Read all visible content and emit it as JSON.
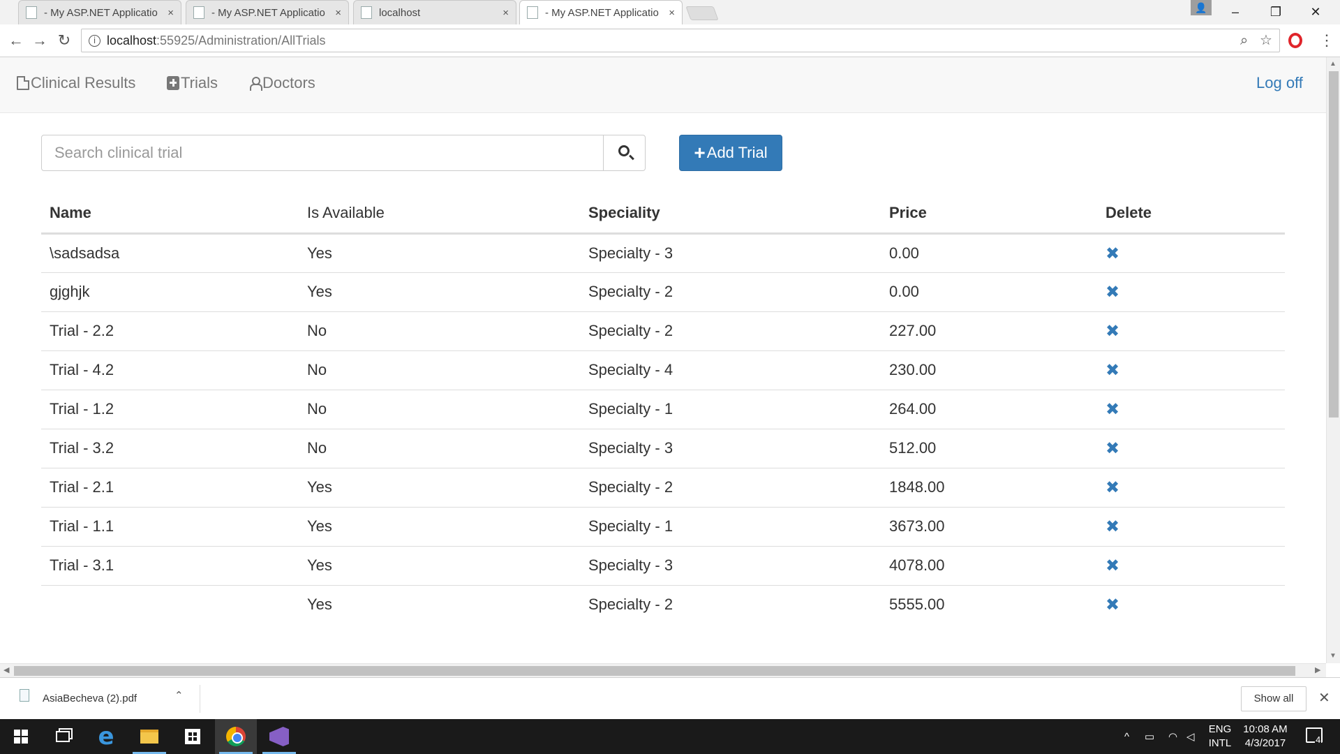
{
  "browser": {
    "tabs": [
      {
        "title": "- My ASP.NET Applicatio",
        "active": false
      },
      {
        "title": "- My ASP.NET Applicatio",
        "active": false
      },
      {
        "title": "localhost",
        "active": false
      },
      {
        "title": "- My ASP.NET Applicatio",
        "active": true
      }
    ],
    "tab_close": "×",
    "url_host": "localhost",
    "url_path": ":55925/Administration/AllTrials",
    "info_glyph": "i",
    "window_buttons": {
      "minimize": "–",
      "restore": "❐",
      "close": "✕"
    },
    "nav": {
      "back": "←",
      "forward": "→",
      "reload": "↻"
    },
    "zoom_glyph": "⌕",
    "star_glyph": "☆",
    "menu_glyph": "⋮",
    "user_glyph": "👤"
  },
  "navbar": {
    "links": [
      {
        "label": "Clinical Results",
        "icon": "file-icon"
      },
      {
        "label": "Trials",
        "icon": "plus-square-icon"
      },
      {
        "label": "Doctors",
        "icon": "user-icon"
      }
    ],
    "logoff": "Log off"
  },
  "search": {
    "placeholder": "Search clinical trial",
    "value": ""
  },
  "add_button": {
    "plus": "+",
    "label": "Add Trial"
  },
  "table": {
    "headers": [
      "Name",
      "Is Available",
      "Speciality",
      "Price",
      "Delete"
    ],
    "rows": [
      {
        "name": "\\sadsadsa",
        "available": "Yes",
        "speciality": "Specialty - 3",
        "price": "0.00"
      },
      {
        "name": "gjghjk",
        "available": "Yes",
        "speciality": "Specialty - 2",
        "price": "0.00"
      },
      {
        "name": "Trial - 2.2",
        "available": "No",
        "speciality": "Specialty - 2",
        "price": "227.00"
      },
      {
        "name": "Trial - 4.2",
        "available": "No",
        "speciality": "Specialty - 4",
        "price": "230.00"
      },
      {
        "name": "Trial - 1.2",
        "available": "No",
        "speciality": "Specialty - 1",
        "price": "264.00"
      },
      {
        "name": "Trial - 3.2",
        "available": "No",
        "speciality": "Specialty - 3",
        "price": "512.00"
      },
      {
        "name": "Trial - 2.1",
        "available": "Yes",
        "speciality": "Specialty - 2",
        "price": "1848.00"
      },
      {
        "name": "Trial - 1.1",
        "available": "Yes",
        "speciality": "Specialty - 1",
        "price": "3673.00"
      },
      {
        "name": "Trial - 3.1",
        "available": "Yes",
        "speciality": "Specialty - 3",
        "price": "4078.00"
      },
      {
        "name": "",
        "available": "Yes",
        "speciality": "Specialty - 2",
        "price": "5555.00"
      }
    ],
    "delete_glyph": "✖",
    "link_color": "#337ab7"
  },
  "downloads": {
    "file": "AsiaBecheva (2).pdf",
    "chevron": "⌃",
    "show_all": "Show all",
    "close": "✕"
  },
  "taskbar": {
    "edge_glyph": "e",
    "tray_chevron": "^",
    "lang_top": "ENG",
    "lang_bottom": "INTL",
    "time": "10:08 AM",
    "date": "4/3/2017",
    "notification_count": "4",
    "accent_color": "#76b9ed"
  }
}
